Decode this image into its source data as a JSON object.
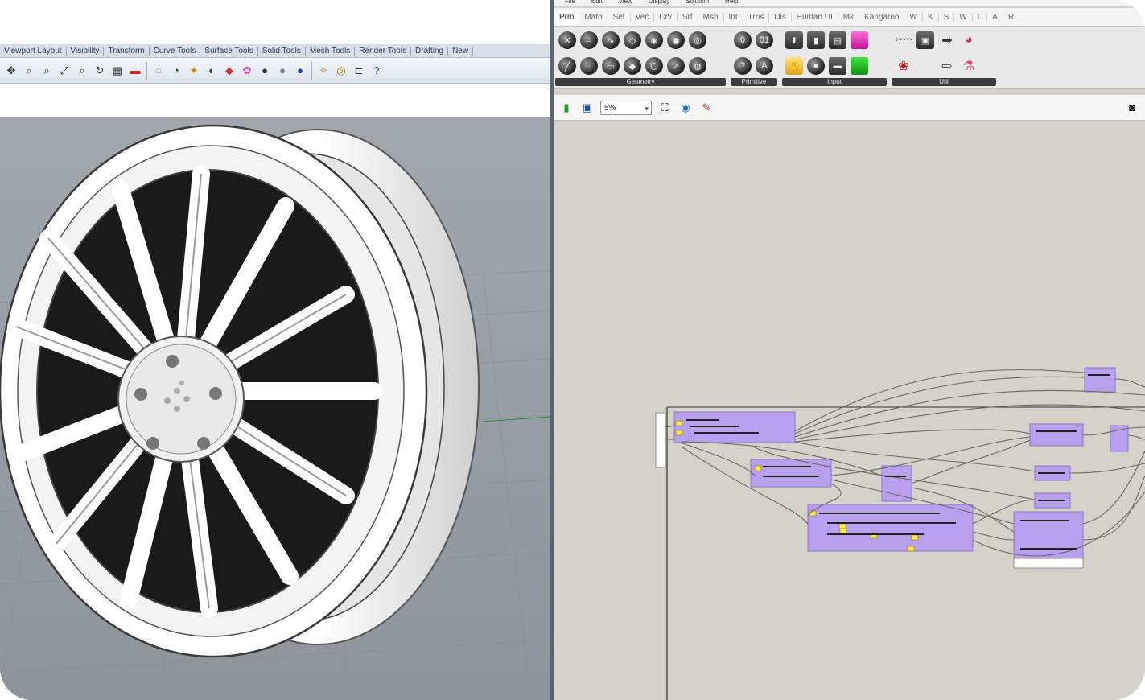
{
  "rhino": {
    "tabs": [
      "Viewport Layout",
      "Visibility",
      "Transform",
      "Curve Tools",
      "Surface Tools",
      "Solid Tools",
      "Mesh Tools",
      "Render Tools",
      "Drafting",
      "New"
    ],
    "toolbar_icons": [
      "pan-icon",
      "zoom-icon",
      "zoom-window-icon",
      "zoom-extents-icon",
      "zoom-selected-icon",
      "rotate-view-icon",
      "grid-icon",
      "hide-icon",
      "show-icon",
      "lock-icon",
      "light-icon",
      "properties-icon",
      "color-wheel-icon",
      "shade-icon",
      "render-icon",
      "rendered-sphere-icon",
      "filter-icon",
      "snap-icon",
      "osnap-icon",
      "help-icon"
    ],
    "viewport": {
      "subject": "wheel-rim-model",
      "wheel_fill": "#ffffff",
      "background": "#9ea3a8"
    }
  },
  "grasshopper": {
    "menu": [
      "File",
      "Edit",
      "View",
      "Display",
      "Solution",
      "Help"
    ],
    "tabs": [
      "Prm",
      "Math",
      "Set",
      "Vec",
      "Crv",
      "Srf",
      "Msh",
      "Int",
      "Trns",
      "Dis",
      "Human UI",
      "Mk",
      "Kangaroo",
      "W",
      "K",
      "S",
      "W",
      "L",
      "A",
      "R"
    ],
    "active_tab": "Prm",
    "groups": [
      {
        "label": "Geometry",
        "icon_count": 14
      },
      {
        "label": "Primitive",
        "icon_count": 4
      },
      {
        "label": "Input",
        "icon_count": 6
      },
      {
        "label": "Util",
        "icon_count": 6
      }
    ],
    "toolbar": {
      "zoom": "5%",
      "icons": [
        "open-file-icon",
        "save-icon",
        "zoom-extents-icon",
        "preview-eye-icon",
        "paint-icon"
      ]
    },
    "canvas": {
      "group_color": "#b9a0ef",
      "wire_color": "#6a6a66"
    }
  }
}
